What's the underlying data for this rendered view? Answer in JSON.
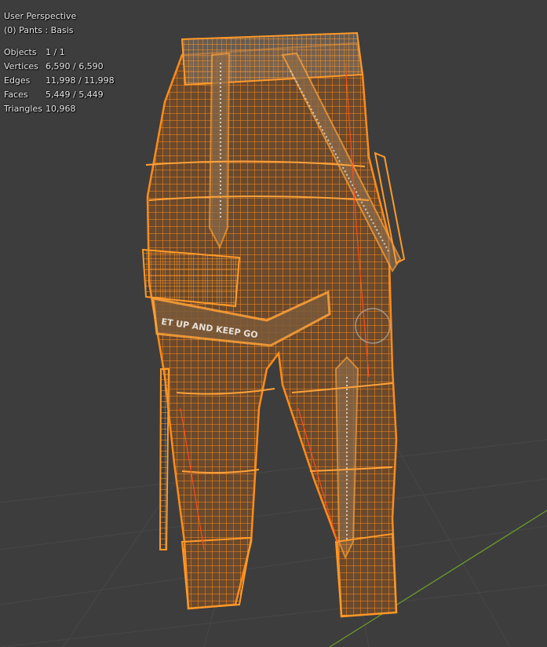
{
  "viewport": {
    "view_name": "User Perspective",
    "object_label": "(0) Pants : Basis",
    "stats": [
      {
        "label": "Objects",
        "value": "1 / 1"
      },
      {
        "label": "Vertices",
        "value": "6,590 / 6,590"
      },
      {
        "label": "Edges",
        "value": "11,998 / 11,998"
      },
      {
        "label": "Faces",
        "value": "5,449 / 5,449"
      },
      {
        "label": "Triangles",
        "value": "10,968"
      }
    ],
    "mesh_text": {
      "belt_text": "ET UP AND KEEP GO"
    }
  },
  "colors": {
    "background": "#3d3d3d",
    "grid_line": "#4a4a4a",
    "x_axis": "#8a3a3a",
    "y_axis": "#6a9a2a",
    "wire": "#ff8c1a",
    "wire_light": "#ffb347",
    "body_fill": "#6e4a2a",
    "selected_edge": "#ff4a1a"
  }
}
